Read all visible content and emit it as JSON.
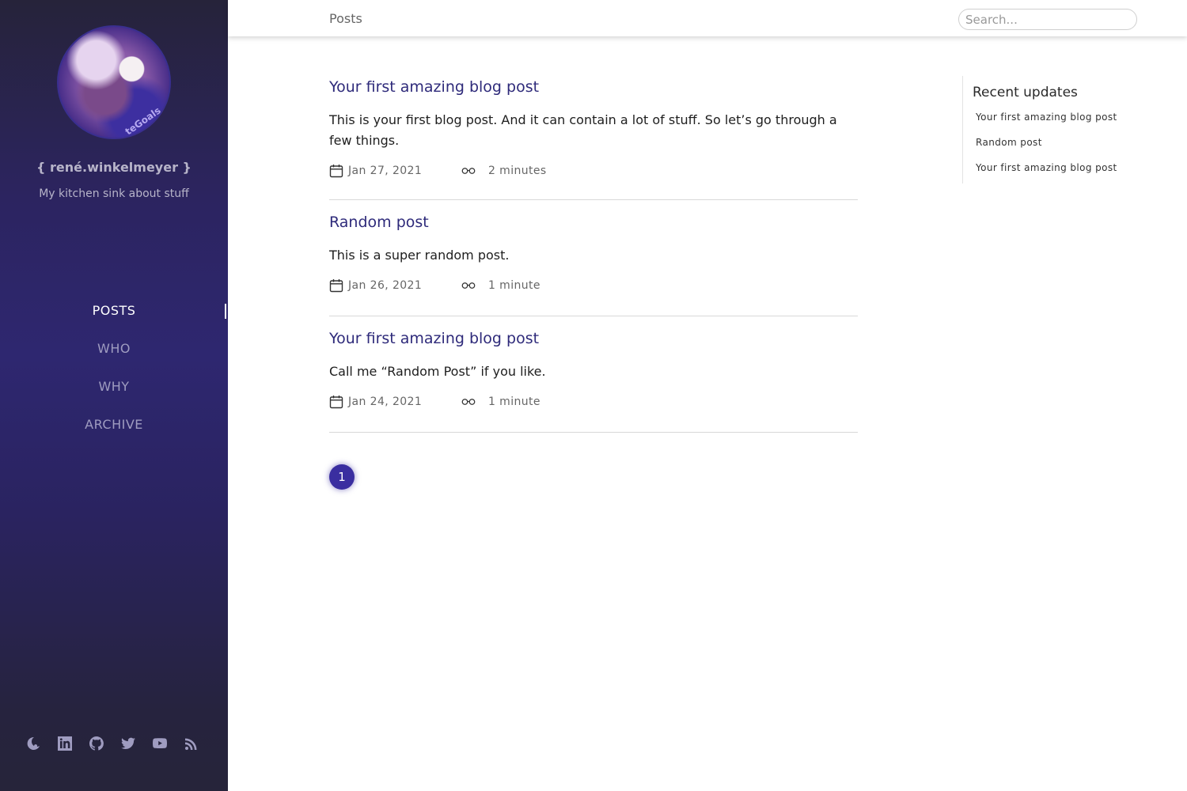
{
  "sidebar": {
    "avatar_text": "teGoals",
    "site_title": "{ rené.winkelmeyer }",
    "site_subtitle": "My kitchen sink about stuff",
    "nav": [
      {
        "label": "POSTS",
        "active": true
      },
      {
        "label": "WHO",
        "active": false
      },
      {
        "label": "WHY",
        "active": false
      },
      {
        "label": "ARCHIVE",
        "active": false
      }
    ],
    "social_icons": [
      "theme-toggle-icon",
      "linkedin-icon",
      "github-icon",
      "twitter-icon",
      "youtube-icon",
      "rss-icon"
    ]
  },
  "header": {
    "title": "Posts",
    "search_placeholder": "Search..."
  },
  "posts": [
    {
      "title": "Your first amazing blog post",
      "excerpt": "This is your first blog post. And it can contain a lot of stuff. So let’s go through a few things.",
      "date": "Jan 27, 2021",
      "reading_time": "2 minutes"
    },
    {
      "title": "Random post",
      "excerpt": "This is a super random post.",
      "date": "Jan 26, 2021",
      "reading_time": "1 minute"
    },
    {
      "title": "Your first amazing blog post",
      "excerpt": "Call me “Random Post” if you like.",
      "date": "Jan 24, 2021",
      "reading_time": "1 minute"
    }
  ],
  "pagination": {
    "current_page": "1"
  },
  "recent_updates": {
    "heading": "Recent updates",
    "items": [
      "Your first amazing blog post",
      "Random post",
      "Your first amazing blog post"
    ]
  },
  "colors": {
    "accent": "#2e2a7a",
    "page_button": "#3a2ea0",
    "sidebar_text": "#9f9cc0"
  }
}
